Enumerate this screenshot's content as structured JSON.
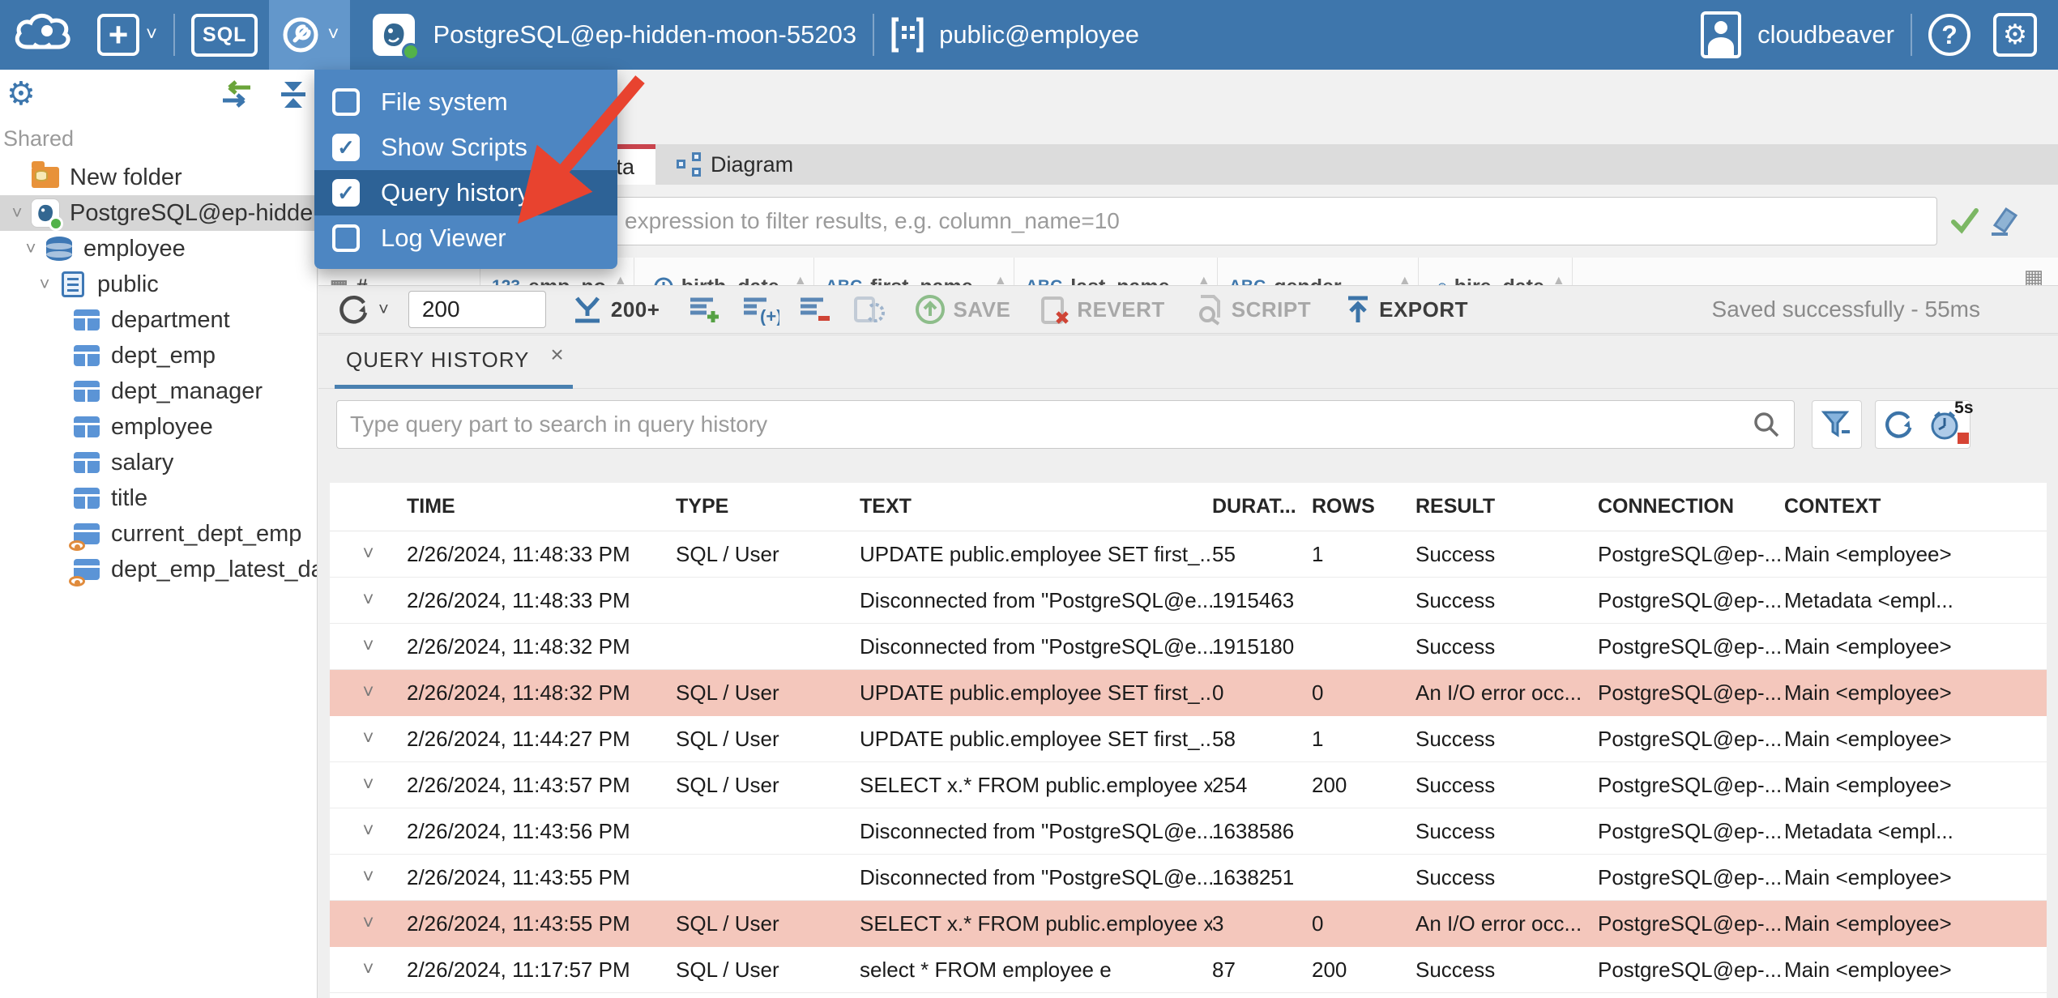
{
  "topbar": {
    "sql_label": "SQL",
    "connection": "PostgreSQL@ep-hidden-moon-55203",
    "schema": "public@employee",
    "user": "cloudbeaver",
    "help": "?"
  },
  "tools_menu": {
    "items": [
      {
        "label": "File system",
        "checked": false,
        "selected": false
      },
      {
        "label": "Show Scripts",
        "checked": true,
        "selected": false
      },
      {
        "label": "Query history",
        "checked": true,
        "selected": true
      },
      {
        "label": "Log Viewer",
        "checked": false,
        "selected": false
      }
    ]
  },
  "sidebar": {
    "section": "Shared",
    "tree": [
      {
        "label": "New folder",
        "icon": "folder",
        "level": 1,
        "chevron": false,
        "selected": false
      },
      {
        "label": "PostgreSQL@ep-hidden-",
        "icon": "postgres",
        "level": 1,
        "chevron": true,
        "selected": true
      },
      {
        "label": "employee",
        "icon": "database",
        "level": 2,
        "chevron": true,
        "selected": false
      },
      {
        "label": "public",
        "icon": "schema",
        "level": 3,
        "chevron": true,
        "selected": false
      },
      {
        "label": "department",
        "icon": "table",
        "level": 4,
        "chevron": false,
        "selected": false
      },
      {
        "label": "dept_emp",
        "icon": "table",
        "level": 4,
        "chevron": false,
        "selected": false
      },
      {
        "label": "dept_manager",
        "icon": "table",
        "level": 4,
        "chevron": false,
        "selected": false
      },
      {
        "label": "employee",
        "icon": "table",
        "level": 4,
        "chevron": false,
        "selected": false
      },
      {
        "label": "salary",
        "icon": "table",
        "level": 4,
        "chevron": false,
        "selected": false
      },
      {
        "label": "title",
        "icon": "table",
        "level": 4,
        "chevron": false,
        "selected": false
      },
      {
        "label": "current_dept_emp",
        "icon": "view",
        "level": 4,
        "chevron": false,
        "selected": false
      },
      {
        "label": "dept_emp_latest_date",
        "icon": "view",
        "level": 4,
        "chevron": false,
        "selected": false
      }
    ]
  },
  "editor": {
    "tabs": {
      "data": "Data",
      "diagram": "Diagram"
    },
    "filter_placeholder": "expression to filter results, e.g. column_name=10"
  },
  "grid": {
    "row_number_header": "#",
    "columns": [
      {
        "glyph": "123",
        "clock": false,
        "label": "emp_no"
      },
      {
        "glyph": "",
        "clock": true,
        "label": "birth_date"
      },
      {
        "glyph": "ABC",
        "clock": false,
        "label": "first_name"
      },
      {
        "glyph": "ABC",
        "clock": false,
        "label": "last_name"
      },
      {
        "glyph": "ABC",
        "clock": false,
        "label": "gender"
      },
      {
        "glyph": "",
        "clock": true,
        "label": "hire_date"
      }
    ]
  },
  "toolbar": {
    "rows_value": "200",
    "fetch_more": "200+",
    "save": "SAVE",
    "revert": "REVERT",
    "script": "SCRIPT",
    "export": "EXPORT",
    "status": "Saved successfully - 55ms"
  },
  "query_history": {
    "tab": "QUERY HISTORY",
    "close": "×",
    "search_placeholder": "Type query part to search in query history",
    "refresh_interval": "5s",
    "columns": [
      "TIME",
      "TYPE",
      "TEXT",
      "DURAT...",
      "ROWS",
      "RESULT",
      "CONNECTION",
      "CONTEXT"
    ],
    "rows": [
      {
        "time": "2/26/2024, 11:48:33 PM",
        "type": "SQL / User",
        "text": "UPDATE public.employee SET first_...",
        "duration": "55",
        "rows": "1",
        "result": "Success",
        "connection": "PostgreSQL@ep-...",
        "context": "Main <employee>",
        "error": false
      },
      {
        "time": "2/26/2024, 11:48:33 PM",
        "type": "",
        "text": "Disconnected from \"PostgreSQL@e...",
        "duration": "1915463",
        "rows": "",
        "result": "Success",
        "connection": "PostgreSQL@ep-...",
        "context": "Metadata <empl...",
        "error": false
      },
      {
        "time": "2/26/2024, 11:48:32 PM",
        "type": "",
        "text": "Disconnected from \"PostgreSQL@e...",
        "duration": "1915180",
        "rows": "",
        "result": "Success",
        "connection": "PostgreSQL@ep-...",
        "context": "Main <employee>",
        "error": false
      },
      {
        "time": "2/26/2024, 11:48:32 PM",
        "type": "SQL / User",
        "text": "UPDATE public.employee SET first_...",
        "duration": "0",
        "rows": "0",
        "result": "An I/O error occ...",
        "connection": "PostgreSQL@ep-...",
        "context": "Main <employee>",
        "error": true
      },
      {
        "time": "2/26/2024, 11:44:27 PM",
        "type": "SQL / User",
        "text": "UPDATE public.employee SET first_...",
        "duration": "58",
        "rows": "1",
        "result": "Success",
        "connection": "PostgreSQL@ep-...",
        "context": "Main <employee>",
        "error": false
      },
      {
        "time": "2/26/2024, 11:43:57 PM",
        "type": "SQL / User",
        "text": "SELECT x.* FROM public.employee x",
        "duration": "254",
        "rows": "200",
        "result": "Success",
        "connection": "PostgreSQL@ep-...",
        "context": "Main <employee>",
        "error": false
      },
      {
        "time": "2/26/2024, 11:43:56 PM",
        "type": "",
        "text": "Disconnected from \"PostgreSQL@e...",
        "duration": "1638586",
        "rows": "",
        "result": "Success",
        "connection": "PostgreSQL@ep-...",
        "context": "Metadata <empl...",
        "error": false
      },
      {
        "time": "2/26/2024, 11:43:55 PM",
        "type": "",
        "text": "Disconnected from \"PostgreSQL@e...",
        "duration": "1638251",
        "rows": "",
        "result": "Success",
        "connection": "PostgreSQL@ep-...",
        "context": "Main <employee>",
        "error": false
      },
      {
        "time": "2/26/2024, 11:43:55 PM",
        "type": "SQL / User",
        "text": "SELECT x.* FROM public.employee x",
        "duration": "3",
        "rows": "0",
        "result": "An I/O error occ...",
        "connection": "PostgreSQL@ep-...",
        "context": "Main <employee>",
        "error": true
      },
      {
        "time": "2/26/2024, 11:17:57 PM",
        "type": "SQL / User",
        "text": "select * FROM employee e",
        "duration": "87",
        "rows": "200",
        "result": "Success",
        "connection": "PostgreSQL@ep-...",
        "context": "Main <employee>",
        "error": false
      }
    ]
  },
  "colors": {
    "topbar": "#3e76ac",
    "menu": "#4d86c2",
    "menu_selected": "#2d6296",
    "accent_red": "#c9444d",
    "arrow_red": "#e8432f",
    "error_row": "#f4c7bc",
    "tab_underline": "#4a80b0",
    "success_green": "#53b24a"
  }
}
